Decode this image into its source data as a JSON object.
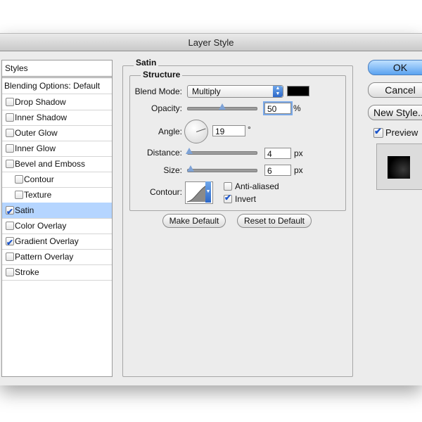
{
  "window": {
    "title": "Layer Style"
  },
  "styles_panel": {
    "header": "Styles",
    "items": [
      {
        "label": "Blending Options: Default",
        "checkbox": false,
        "checked": false,
        "selected": false
      },
      {
        "label": "Drop Shadow",
        "checkbox": true,
        "checked": false,
        "selected": false
      },
      {
        "label": "Inner Shadow",
        "checkbox": true,
        "checked": false,
        "selected": false
      },
      {
        "label": "Outer Glow",
        "checkbox": true,
        "checked": false,
        "selected": false
      },
      {
        "label": "Inner Glow",
        "checkbox": true,
        "checked": false,
        "selected": false
      },
      {
        "label": "Bevel and Emboss",
        "checkbox": true,
        "checked": false,
        "selected": false
      },
      {
        "label": "Contour",
        "checkbox": true,
        "checked": false,
        "selected": false,
        "indent": true
      },
      {
        "label": "Texture",
        "checkbox": true,
        "checked": false,
        "selected": false,
        "indent": true
      },
      {
        "label": "Satin",
        "checkbox": true,
        "checked": true,
        "selected": true
      },
      {
        "label": "Color Overlay",
        "checkbox": true,
        "checked": false,
        "selected": false
      },
      {
        "label": "Gradient Overlay",
        "checkbox": true,
        "checked": true,
        "selected": false
      },
      {
        "label": "Pattern Overlay",
        "checkbox": true,
        "checked": false,
        "selected": false
      },
      {
        "label": "Stroke",
        "checkbox": true,
        "checked": false,
        "selected": false
      }
    ]
  },
  "satin": {
    "section_title": "Satin",
    "structure_title": "Structure",
    "blend_mode": {
      "label": "Blend Mode:",
      "value": "Multiply",
      "color": "#000000"
    },
    "opacity": {
      "label": "Opacity:",
      "value": "50",
      "unit": "%",
      "level": 0.5
    },
    "angle": {
      "label": "Angle:",
      "value": "19",
      "unit": "°"
    },
    "distance": {
      "label": "Distance:",
      "value": "4",
      "unit": "px"
    },
    "size": {
      "label": "Size:",
      "value": "6",
      "unit": "px"
    },
    "contour": {
      "label": "Contour:"
    },
    "anti_aliased": {
      "label": "Anti-aliased",
      "checked": false
    },
    "invert": {
      "label": "Invert",
      "checked": true
    },
    "make_default": "Make Default",
    "reset_default": "Reset to Default"
  },
  "actions": {
    "ok": "OK",
    "cancel": "Cancel",
    "new_style": "New Style...",
    "preview": {
      "label": "Preview",
      "checked": true
    }
  },
  "colors": {
    "accent": "#5aa2f0",
    "selection": "#b5d5ff"
  }
}
